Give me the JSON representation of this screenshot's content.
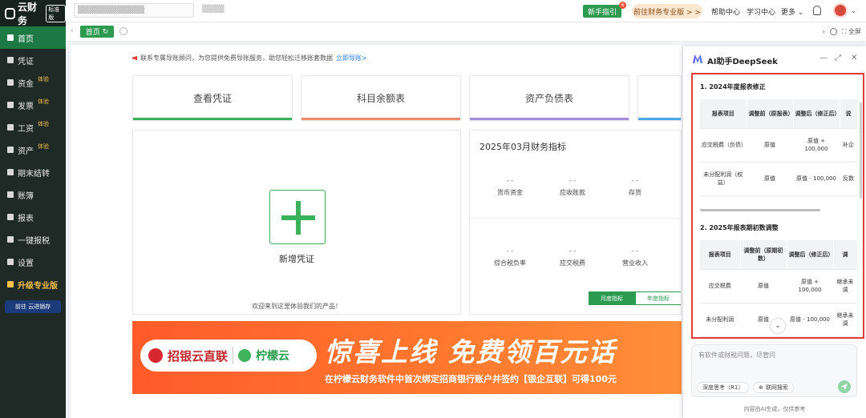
{
  "sidebar": {
    "logo_text": "云财务",
    "logo_badge": "标准版",
    "items": [
      {
        "label": "首页",
        "active": true,
        "sup": ""
      },
      {
        "label": "凭证",
        "sup": ""
      },
      {
        "label": "资金",
        "sup": "体验"
      },
      {
        "label": "发票",
        "sup": "体验"
      },
      {
        "label": "工资",
        "sup": "体验"
      },
      {
        "label": "资产",
        "sup": "体验"
      },
      {
        "label": "期末结转",
        "sup": ""
      },
      {
        "label": "账簿",
        "sup": ""
      },
      {
        "label": "报表",
        "sup": ""
      },
      {
        "label": "一键报税",
        "sup": ""
      },
      {
        "label": "设置",
        "sup": ""
      },
      {
        "label": "升级专业版",
        "sup": ""
      }
    ],
    "banner": "前往 云进销存"
  },
  "topbar": {
    "newbie_label": "新手指引",
    "newbie_badge": "6",
    "pro_label": "前往财务专业版 > >",
    "help": "帮助中心",
    "learn": "学习中心",
    "more": "更多"
  },
  "tabs": {
    "home_label": "首页",
    "fullscreen": "全屏"
  },
  "notice": {
    "text": "联系专属导账顾问，为您提供免费导账服务，助您轻松迁移账套数据",
    "link": "立即导账>"
  },
  "cards": [
    {
      "label": "查看凭证",
      "color": "#3ab15a"
    },
    {
      "label": "科目余额表",
      "color": "#f08a6a"
    },
    {
      "label": "资产负债表",
      "color": "#a58be0"
    },
    {
      "label": "",
      "color": "#4aa8e8"
    }
  ],
  "new_voucher": {
    "label": "新增凭证",
    "welcome": "欢迎来到这里体验我们的产品！"
  },
  "financial": {
    "title": "2025年03月财务指标",
    "metrics_row1": [
      {
        "value": "- -",
        "label": "货币资金"
      },
      {
        "value": "- -",
        "label": "应收账款"
      },
      {
        "value": "- -",
        "label": "存货"
      }
    ],
    "metrics_row2": [
      {
        "value": "- -",
        "label": "综合税负率"
      },
      {
        "value": "- -",
        "label": "应交税费"
      },
      {
        "value": "- -",
        "label": "营业收入"
      }
    ],
    "toggle_month": "月度指标",
    "toggle_year": "年度指标"
  },
  "ad": {
    "brand1": "招银云直联",
    "brand2": "柠檬云",
    "headline": "惊喜上线  免费领百元话",
    "subline": "在柠檬云财务软件中首次绑定招商银行账户并签约【银企互联】可得100元"
  },
  "ai": {
    "title": "AI助手DeepSeek",
    "section1_title": "1. 2024年度报表修正",
    "table1": {
      "headers": [
        "报表项目",
        "调整前（原报表）",
        "调整后（修正后）",
        "说"
      ],
      "rows": [
        [
          "应交税费（负债）",
          "原值",
          "原值 + 100,000",
          "补企"
        ],
        [
          "未分配利润（权益）",
          "原值",
          "原值 - 100,000",
          "反数"
        ]
      ]
    },
    "section2_title": "2. 2025年报表期初数调整",
    "table2": {
      "headers": [
        "报表项目",
        "调整前（原期初数）",
        "调整后（修正后）",
        "调"
      ],
      "rows": [
        [
          "应交税费",
          "原值",
          "原值 + 100,000",
          "继承未调"
        ],
        [
          "未分配利润",
          "原值",
          "原值 - 100,000",
          "继承未调"
        ]
      ]
    },
    "input_placeholder": "有软件或财税问题，尽管问",
    "chip_deep": "深度思考（R1）",
    "chip_web": "联网搜索",
    "footer": "内容由AI生成，仅供参考"
  }
}
